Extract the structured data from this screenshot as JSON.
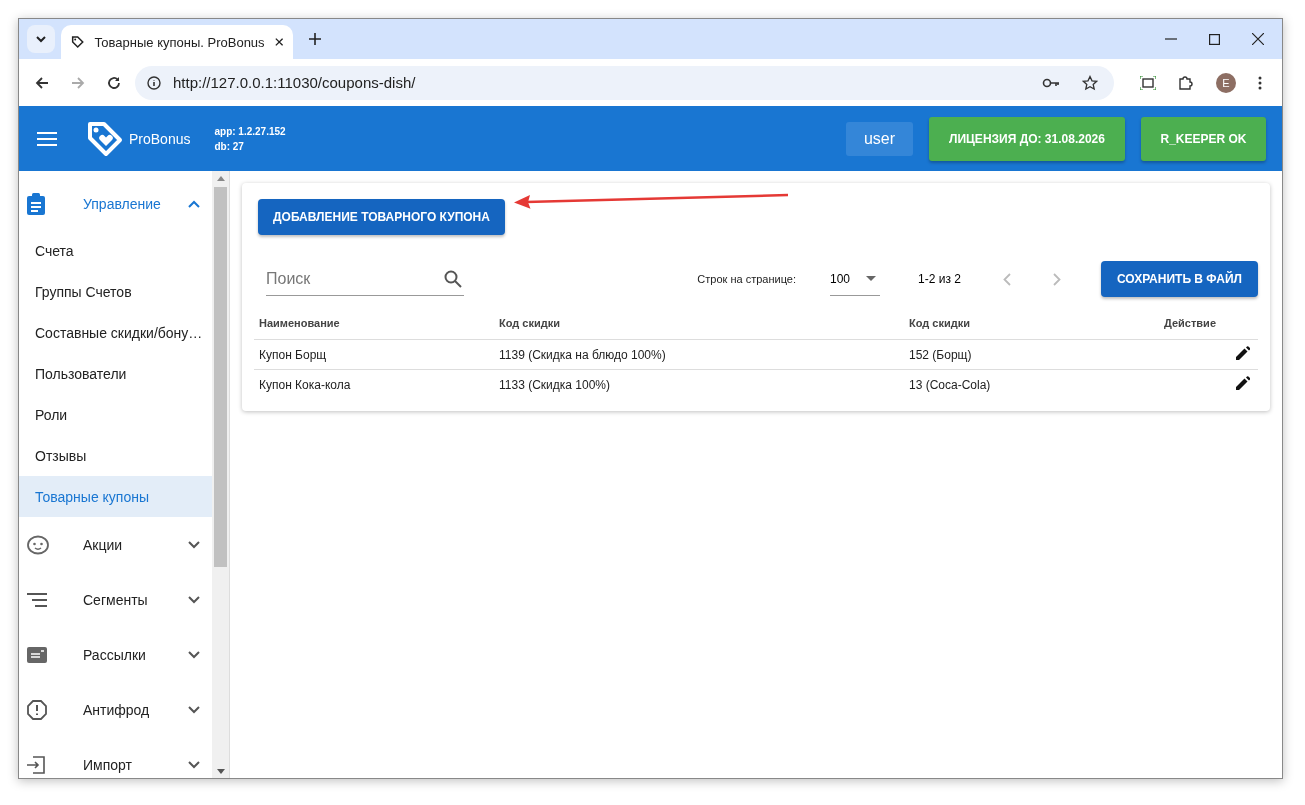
{
  "browser": {
    "tab_title": "Товарные купоны. ProBonus",
    "url": "http://127.0.0.1:11030/coupons-dish/",
    "profile_initial": "E"
  },
  "header": {
    "brand": "ProBonus",
    "app_version": "app: 1.2.27.152",
    "db_version": "db: 27",
    "user": "user",
    "license": "ЛИЦЕНЗИЯ ДО: 31.08.2026",
    "rkeeper": "R_KEEPER OK"
  },
  "sidebar": [
    {
      "label": "Управление",
      "kind": "clipboard",
      "expanded": true,
      "children": [
        {
          "label": "Счета",
          "selected": false
        },
        {
          "label": "Группы Счетов",
          "selected": false
        },
        {
          "label": "Составные скидки/бону…",
          "selected": false
        },
        {
          "label": "Пользователи",
          "selected": false
        },
        {
          "label": "Роли",
          "selected": false
        },
        {
          "label": "Отзывы",
          "selected": false
        },
        {
          "label": "Товарные купоны",
          "selected": true
        }
      ]
    },
    {
      "label": "Акции",
      "kind": "face",
      "expanded": false
    },
    {
      "label": "Сегменты",
      "kind": "segments",
      "expanded": false
    },
    {
      "label": "Рассылки",
      "kind": "mail",
      "expanded": false
    },
    {
      "label": "Антифрод",
      "kind": "alert",
      "expanded": false
    },
    {
      "label": "Импорт",
      "kind": "import",
      "expanded": false
    }
  ],
  "content": {
    "add_button": "ДОБАВЛЕНИЕ ТОВАРНОГО КУПОНА",
    "search": {
      "placeholder": "Поиск"
    },
    "rows_per_page_label": "Строк на странице:",
    "rows_per_page": "100",
    "range": "1-2 из 2",
    "save_button": "СОХРАНИТЬ В ФАЙЛ",
    "table": {
      "columns": [
        "Наименование",
        "Код скидки",
        "Код скидки",
        "Действие"
      ],
      "rows": [
        {
          "name": "Купон Борщ",
          "discount_code": "1139 (Скидка на блюдо 100%)",
          "dish_code": "152 (Борщ)"
        },
        {
          "name": "Купон Кока-кола",
          "discount_code": "1133 (Скидка 100%)",
          "dish_code": "13 (Coca-Cola)"
        }
      ]
    }
  }
}
